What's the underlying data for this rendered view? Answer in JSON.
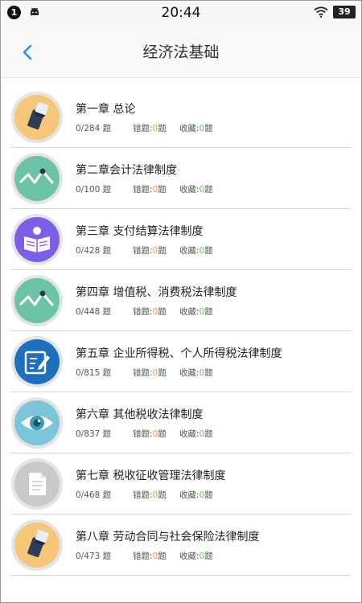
{
  "statusbar": {
    "notification_count": "1",
    "time": "20:44",
    "battery": "39",
    "icons": [
      "notification-badge",
      "android-icon",
      "wifi-icon",
      "battery-icon"
    ]
  },
  "header": {
    "title": "经济法基础",
    "back_icon": "chevron-left-icon"
  },
  "labels": {
    "wrong_label": "错题:",
    "fav_label": "收藏:",
    "unit": "题"
  },
  "colors": {
    "accent_blue": "#2f8ee6",
    "wrong_num": "#f0a04b",
    "fav_num": "#6cc26c"
  },
  "chapters": [
    {
      "title": "第一章 总论",
      "progress": "0/284",
      "wrong": "0",
      "fav": "0",
      "icon": "sticker-icon"
    },
    {
      "title": "第二章会计法律制度",
      "progress": "0/100",
      "wrong": "0",
      "fav": "0",
      "icon": "line-chart-icon"
    },
    {
      "title": "第三章 支付结算法律制度",
      "progress": "0/428",
      "wrong": "0",
      "fav": "0",
      "icon": "reading-icon"
    },
    {
      "title": "第四章 增值税、消费税法律制度",
      "progress": "0/448",
      "wrong": "0",
      "fav": "0",
      "icon": "line-chart-icon"
    },
    {
      "title": "第五章 企业所得税、个人所得税法律制度",
      "progress": "0/815",
      "wrong": "0",
      "fav": "0",
      "icon": "edit-icon"
    },
    {
      "title": "第六章 其他税收法律制度",
      "progress": "0/837",
      "wrong": "0",
      "fav": "0",
      "icon": "eye-icon"
    },
    {
      "title": "第七章 税收征收管理法律制度",
      "progress": "0/468",
      "wrong": "0",
      "fav": "0",
      "icon": "document-icon"
    },
    {
      "title": "第八章 劳动合同与社会保险法律制度",
      "progress": "0/473",
      "wrong": "0",
      "fav": "0",
      "icon": "sticker-icon"
    }
  ]
}
